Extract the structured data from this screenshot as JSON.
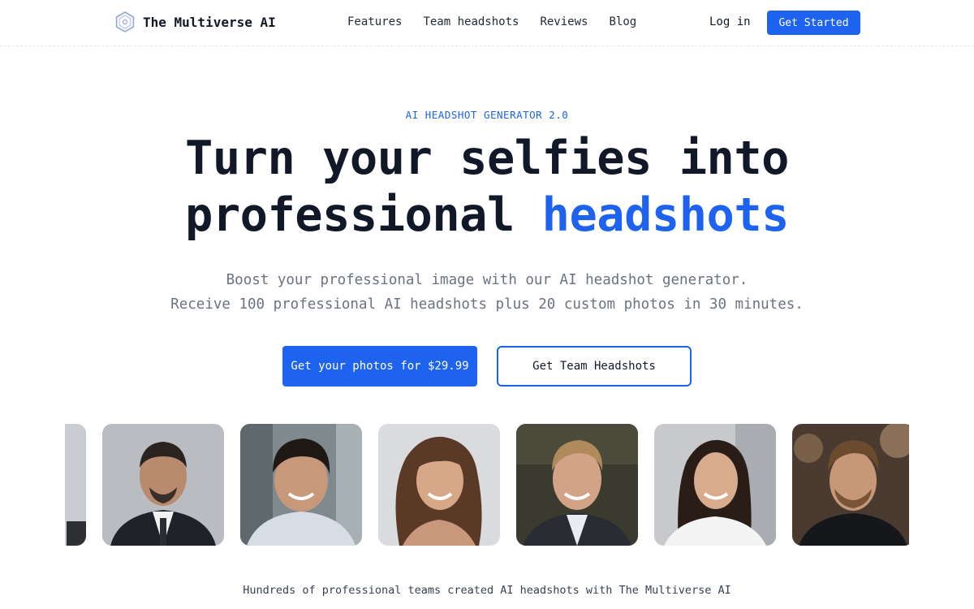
{
  "header": {
    "brand": "The Multiverse AI",
    "nav": [
      "Features",
      "Team headshots",
      "Reviews",
      "Blog"
    ],
    "login": "Log in",
    "cta": "Get Started"
  },
  "hero": {
    "eyebrow": "AI HEADSHOT GENERATOR 2.0",
    "headline_line1": "Turn your selfies into",
    "headline_line2_plain": "professional ",
    "headline_line2_accent": "headshots",
    "subtitle_line1": "Boost your professional image with our AI headshot generator.",
    "subtitle_line2": "Receive 100 professional AI headshots plus 20 custom photos in 30 minutes.",
    "primary_button": "Get your photos for $29.99",
    "secondary_button": "Get Team Headshots"
  },
  "gallery": {
    "photos": [
      {
        "subject": "partial-portrait"
      },
      {
        "subject": "man-bald-suit"
      },
      {
        "subject": "young-man-smiling"
      },
      {
        "subject": "woman-brown-hair"
      },
      {
        "subject": "man-blond-suit"
      },
      {
        "subject": "woman-white-blouse"
      },
      {
        "subject": "man-beard-dark-shirt"
      }
    ]
  },
  "footer_note": "Hundreds of professional teams created AI headshots with The Multiverse AI",
  "colors": {
    "accent": "#1d63f0",
    "text": "#111827",
    "muted": "#6b7280"
  }
}
